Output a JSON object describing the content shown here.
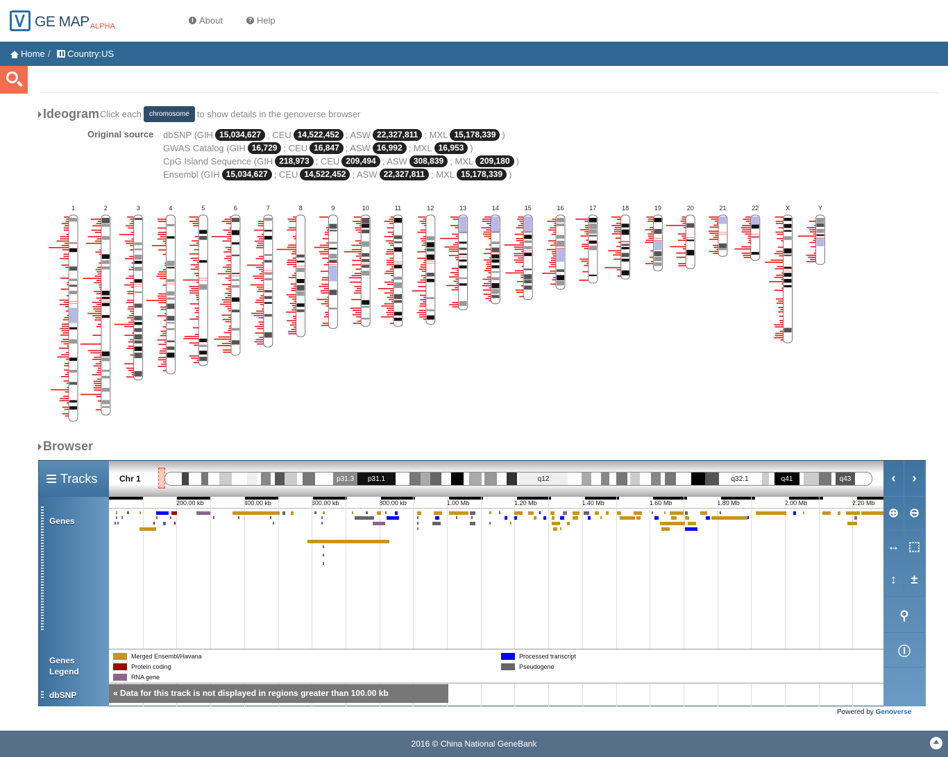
{
  "nav": {
    "logo_text": "GE MAP",
    "logo_alpha": "ALPHA",
    "about": "About",
    "help": "Help",
    "about_icon": "info-icon",
    "help_icon": "question-icon"
  },
  "breadcrumb": {
    "home": "Home",
    "separator": "/",
    "country": "Country:US"
  },
  "ideogram": {
    "title": "Ideogram",
    "hint_before": "Click each",
    "hint_button": "chromosome",
    "hint_after": "to show details in the genoverse browser",
    "source_label": "Original source",
    "sources": [
      {
        "name": "dbSNP (GIH",
        "counts": [
          [
            "",
            "15,034,627"
          ],
          [
            "; CEU",
            "14,522,452"
          ],
          [
            "; ASW",
            "22,327,811"
          ],
          [
            "; MXL",
            "15,178,339"
          ]
        ],
        "close": ")"
      },
      {
        "name": "GWAS Catalog (GIH",
        "counts": [
          [
            "",
            "16,729"
          ],
          [
            "; CEU",
            "16,847"
          ],
          [
            "; ASW",
            "16,992"
          ],
          [
            "; MXL",
            "16,953"
          ]
        ],
        "close": ")"
      },
      {
        "name": "CpG Island Sequence (GIH",
        "counts": [
          [
            "",
            "218,973"
          ],
          [
            "; CEU",
            "209,494"
          ],
          [
            "; ASW",
            "308,839"
          ],
          [
            "; MXL",
            "209,180"
          ]
        ],
        "close": ")"
      },
      {
        "name": "Ensembl (GIH",
        "counts": [
          [
            "",
            "15,034,627"
          ],
          [
            "; CEU",
            "14,522,452"
          ],
          [
            "; ASW",
            "22,327,811"
          ],
          [
            "; MXL",
            "15,178,339"
          ]
        ],
        "close": ")"
      }
    ],
    "chromosomes": [
      {
        "name": "1",
        "rel_length": 1.0
      },
      {
        "name": "2",
        "rel_length": 0.97
      },
      {
        "name": "3",
        "rel_length": 0.8
      },
      {
        "name": "4",
        "rel_length": 0.77
      },
      {
        "name": "5",
        "rel_length": 0.73
      },
      {
        "name": "6",
        "rel_length": 0.68
      },
      {
        "name": "7",
        "rel_length": 0.64
      },
      {
        "name": "8",
        "rel_length": 0.59
      },
      {
        "name": "9",
        "rel_length": 0.55
      },
      {
        "name": "10",
        "rel_length": 0.54
      },
      {
        "name": "11",
        "rel_length": 0.54
      },
      {
        "name": "12",
        "rel_length": 0.53
      },
      {
        "name": "13",
        "rel_length": 0.46
      },
      {
        "name": "14",
        "rel_length": 0.43
      },
      {
        "name": "15",
        "rel_length": 0.41
      },
      {
        "name": "16",
        "rel_length": 0.36
      },
      {
        "name": "17",
        "rel_length": 0.33
      },
      {
        "name": "18",
        "rel_length": 0.31
      },
      {
        "name": "19",
        "rel_length": 0.27
      },
      {
        "name": "20",
        "rel_length": 0.26
      },
      {
        "name": "21",
        "rel_length": 0.2
      },
      {
        "name": "22",
        "rel_length": 0.22
      },
      {
        "name": "X",
        "rel_length": 0.62
      },
      {
        "name": "Y",
        "rel_length": 0.24
      }
    ]
  },
  "browser": {
    "title": "Browser",
    "tracks_label": "Tracks",
    "chromosome_label": "Chr 1",
    "bands": [
      "p31.3",
      "p31.1",
      "q12",
      "q32.1",
      "q41",
      "q43"
    ],
    "ruler_ticks": [
      "200.00 kb",
      "400.00 kb",
      "600.00 kb",
      "800.00 kb",
      "1.00 Mb",
      "1.20 Mb",
      "1.40 Mb",
      "1.60 Mb",
      "1.80 Mb",
      "2.00 Mb",
      "2.20 Mb"
    ],
    "genes_label": "Genes",
    "genes_legend_label": "Genes Legend",
    "dbsnp_label": "dbSNP",
    "legend": [
      {
        "label": "Merged Ensembl/Havana",
        "color": "#c8951b"
      },
      {
        "label": "Protein coding",
        "color": "#a00000"
      },
      {
        "label": "RNA gene",
        "color": "#8b668b"
      },
      {
        "label": "Processed transcript",
        "color": "#0000ff"
      },
      {
        "label": "Pseudogene",
        "color": "#666666"
      }
    ],
    "dbsnp_message": "« Data for this track is not displayed in regions greater than 100.00 kb",
    "controls": [
      "chevron-left-icon",
      "chevron-right-icon",
      "zoom-in-icon",
      "zoom-out-icon",
      "drag-horizontal-icon",
      "select-region-icon",
      "resize-vertical-icon",
      "expand-collapse-icon",
      "location-pin-icon",
      "info-icon"
    ]
  },
  "footer": {
    "powered_prefix": "Powered by",
    "powered_brand": "Genoverse",
    "copyright": "2016 © China National GeneBank"
  }
}
